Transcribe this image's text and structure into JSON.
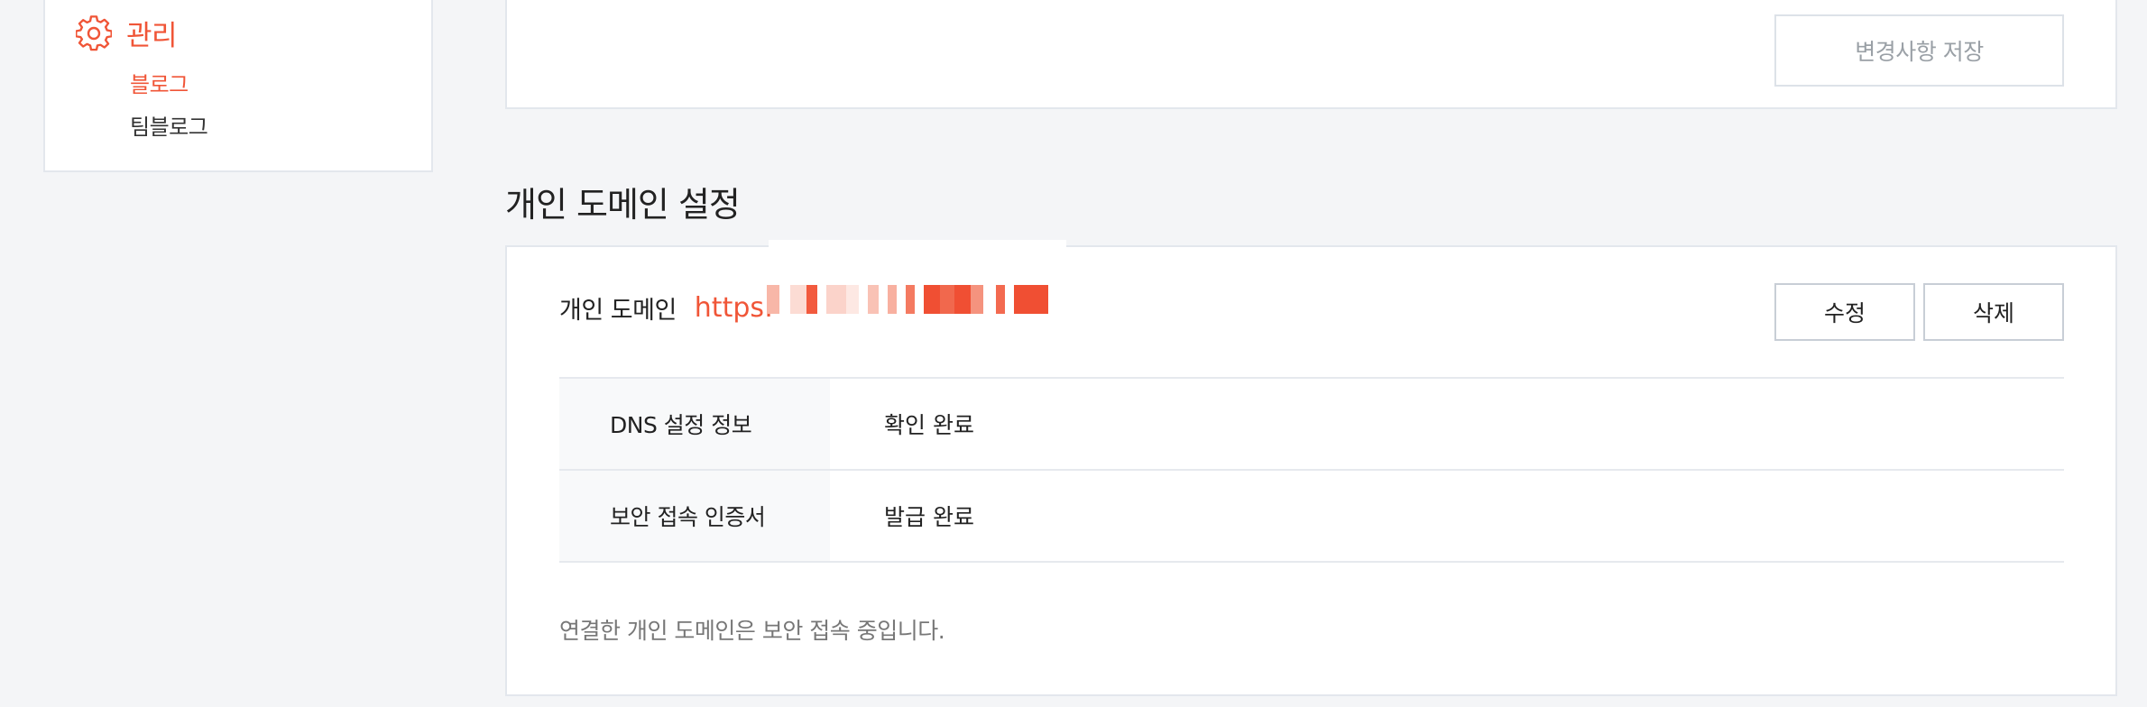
{
  "sidebar": {
    "title": "관리",
    "icon": "gear-icon",
    "items": [
      {
        "label": "블로그",
        "active": true
      },
      {
        "label": "팀블로그",
        "active": false
      }
    ]
  },
  "top_panel": {
    "save_label": "변경사항 저장"
  },
  "custom_domain": {
    "section_title": "개인 도메인 설정",
    "domain_label": "개인 도메인",
    "domain_url_visible": "https:",
    "edit_label": "수정",
    "delete_label": "삭제",
    "rows": [
      {
        "key": "DNS 설정 정보",
        "value": "확인 완료"
      },
      {
        "key": "보안 접속 인증서",
        "value": "발급 완료"
      }
    ],
    "notice": "연결한 개인 도메인은 보안 접속 중입니다."
  },
  "colors": {
    "accent": "#f05537",
    "border": "#e3e7ed",
    "background": "#f4f5f7"
  }
}
